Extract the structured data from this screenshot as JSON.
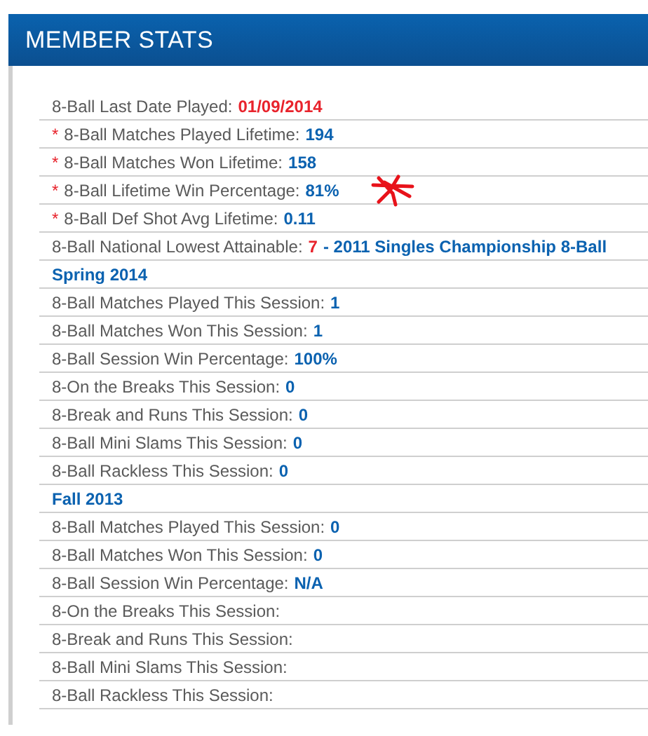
{
  "header": {
    "title": "MEMBER STATS"
  },
  "rows": [
    {
      "kind": "stat",
      "annotated": false,
      "label": "8-Ball Last Date Played:",
      "values": [
        {
          "text": "01/09/2014",
          "alert": true
        }
      ]
    },
    {
      "kind": "stat",
      "marker": "*",
      "annotated": false,
      "label": "8-Ball Matches Played Lifetime:",
      "values": [
        {
          "text": "194",
          "alert": false
        }
      ]
    },
    {
      "kind": "stat",
      "marker": "*",
      "annotated": false,
      "label": "8-Ball Matches Won Lifetime:",
      "values": [
        {
          "text": "158",
          "alert": false
        }
      ]
    },
    {
      "kind": "stat",
      "marker": "*",
      "annotated": true,
      "label": "8-Ball Lifetime Win Percentage:",
      "values": [
        {
          "text": "81%",
          "alert": false
        }
      ]
    },
    {
      "kind": "stat",
      "marker": "*",
      "annotated": false,
      "label": "8-Ball Def Shot Avg Lifetime:",
      "values": [
        {
          "text": "0.11",
          "alert": false
        }
      ]
    },
    {
      "kind": "stat",
      "annotated": false,
      "label": "8-Ball National Lowest Attainable:",
      "values": [
        {
          "text": "7",
          "alert": true
        },
        {
          "text": "- 2011 Singles Championship 8-Ball",
          "alert": false
        }
      ]
    },
    {
      "kind": "session",
      "label": "Spring 2014"
    },
    {
      "kind": "stat",
      "annotated": false,
      "label": "8-Ball Matches Played This Session:",
      "values": [
        {
          "text": "1",
          "alert": false
        }
      ]
    },
    {
      "kind": "stat",
      "annotated": false,
      "label": "8-Ball Matches Won This Session:",
      "values": [
        {
          "text": "1",
          "alert": false
        }
      ]
    },
    {
      "kind": "stat",
      "annotated": false,
      "label": "8-Ball Session Win Percentage:",
      "values": [
        {
          "text": "100%",
          "alert": false
        }
      ]
    },
    {
      "kind": "stat",
      "annotated": false,
      "label": "8-On the Breaks This Session:",
      "values": [
        {
          "text": "0",
          "alert": false
        }
      ]
    },
    {
      "kind": "stat",
      "annotated": false,
      "label": "8-Break and Runs This Session:",
      "values": [
        {
          "text": "0",
          "alert": false
        }
      ]
    },
    {
      "kind": "stat",
      "annotated": false,
      "label": "8-Ball Mini Slams This Session:",
      "values": [
        {
          "text": "0",
          "alert": false
        }
      ]
    },
    {
      "kind": "stat",
      "annotated": false,
      "label": "8-Ball Rackless This Session:",
      "values": [
        {
          "text": "0",
          "alert": false
        }
      ]
    },
    {
      "kind": "session",
      "label": "Fall 2013"
    },
    {
      "kind": "stat",
      "annotated": false,
      "label": "8-Ball Matches Played This Session:",
      "values": [
        {
          "text": "0",
          "alert": false
        }
      ]
    },
    {
      "kind": "stat",
      "annotated": false,
      "label": "8-Ball Matches Won This Session:",
      "values": [
        {
          "text": "0",
          "alert": false
        }
      ]
    },
    {
      "kind": "stat",
      "annotated": false,
      "label": "8-Ball Session Win Percentage:",
      "values": [
        {
          "text": "N/A",
          "alert": false
        }
      ]
    },
    {
      "kind": "stat",
      "annotated": false,
      "label": "8-On the Breaks This Session:"
    },
    {
      "kind": "stat",
      "annotated": false,
      "label": "8-Break and Runs This Session:"
    },
    {
      "kind": "stat",
      "annotated": false,
      "label": "8-Ball Mini Slams This Session:"
    },
    {
      "kind": "stat",
      "annotated": false,
      "label": "8-Ball Rackless This Session:"
    }
  ]
}
